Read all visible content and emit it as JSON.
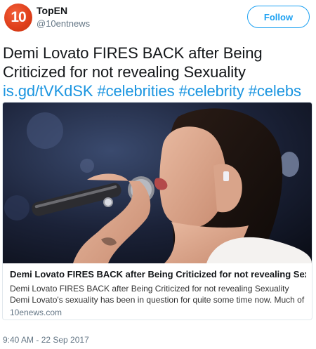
{
  "author": {
    "avatar_text": "10",
    "display_name": "TopEN",
    "handle": "@10entnews"
  },
  "follow_label": "Follow",
  "tweet": {
    "line1": "Demi Lovato FIRES BACK after Being",
    "line2": "Criticized for not revealing Sexuality",
    "link": "is.gd/tVKdSK",
    "hashtags": [
      "#celebrities",
      "#celebrity",
      "#celebs"
    ]
  },
  "card": {
    "title": "Demi Lovato FIRES BACK after Being Criticized for not revealing Sexuality",
    "description": "Demi Lovato FIRES BACK after Being Criticized for not revealing Sexuality Demi Lovato's sexuality has been in question for quite some time now. Much of the spe...",
    "domain": "10enews.com"
  },
  "timestamp": "9:40 AM - 22 Sep 2017",
  "colors": {
    "accent": "#1da1f2",
    "link": "#1b95e0",
    "avatar": "#e0401c"
  }
}
